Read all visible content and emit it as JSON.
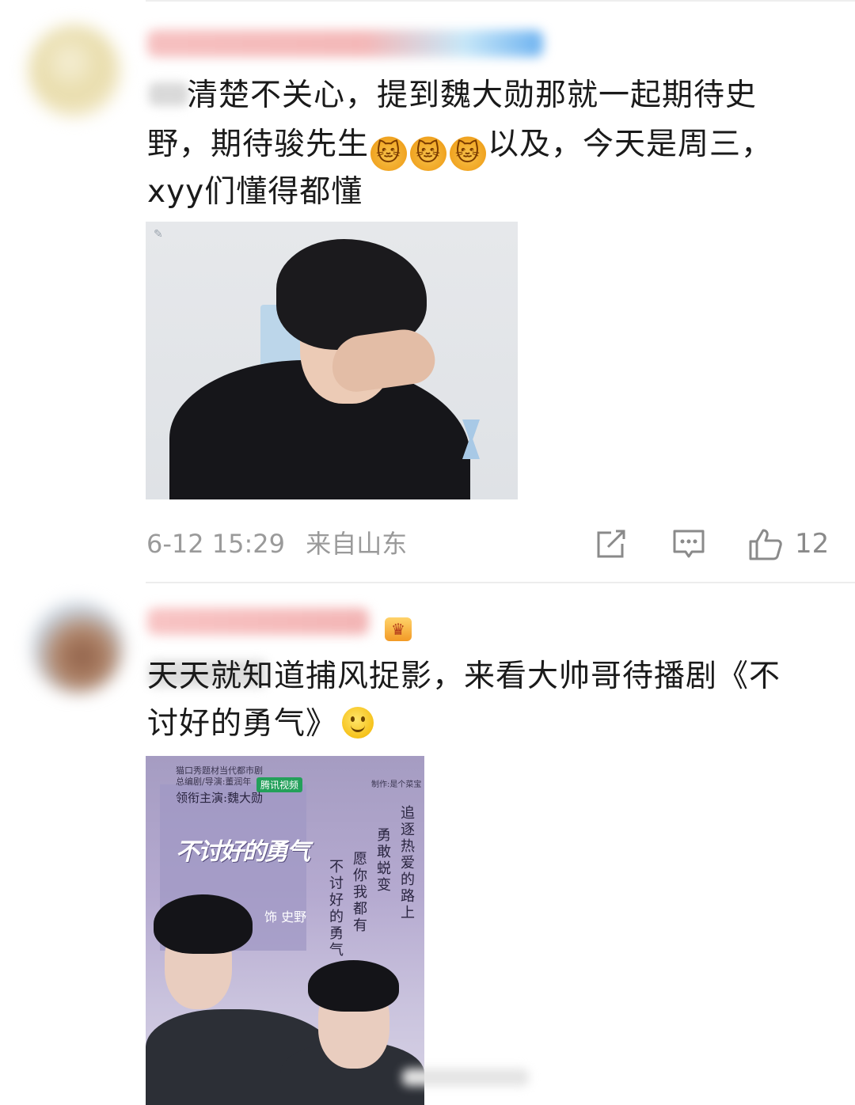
{
  "comments": [
    {
      "avatar": "avatar-blurred",
      "username": "",
      "text_line1": "清楚不关心，提到魏大勋那就一起期待史",
      "text_line2_before": "野，期待骏先生",
      "emojis": [
        "🐱",
        "🐱",
        "🐱"
      ],
      "text_line2_after": "以及，今天是周三，",
      "text_line3": "xyy们懂得都懂",
      "timestamp": "6-12 15:29",
      "location": "来自山东",
      "like_count": "12"
    },
    {
      "avatar": "avatar-blurred",
      "username": "",
      "badge": "crown",
      "text_line1": "天天就知道捕风捉影，来看大帅哥待播剧《不",
      "text_line2": "讨好的勇气》",
      "poster": {
        "small_line1": "猫口秀题材当代都市剧",
        "small_line2": "总编剧/导演:董润年",
        "platform": "腾讯视频",
        "credit": "制作:是个菜宝",
        "lead": "领衔主演:魏大勋",
        "title": "不讨好的勇气",
        "role": "饰 史野",
        "vertical_1": "追逐热爱的路上",
        "vertical_2": "勇敢蜕变",
        "vertical_3": "愿你我都有",
        "vertical_4": "不讨好的勇气"
      }
    }
  ],
  "colors": {
    "text": "#1a1a1a",
    "meta": "#9a9a9a",
    "icon": "#8a8a8a",
    "divider": "#ededed"
  },
  "icons": {
    "share": "share-icon",
    "comment": "comment-icon",
    "like": "thumbs-up-icon"
  }
}
